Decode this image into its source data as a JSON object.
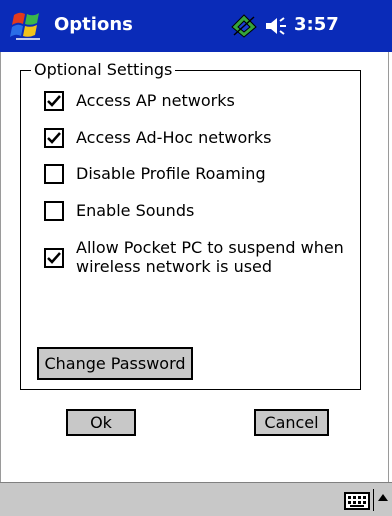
{
  "titlebar": {
    "title": "Options",
    "clock": "3:57"
  },
  "icons": {
    "start": "windows-start-icon",
    "connectivity": "connectivity-icon",
    "volume": "speaker-volume-icon",
    "keyboard": "keyboard-icon",
    "sip_menu": "up-arrow-icon"
  },
  "group": {
    "legend": "Optional Settings",
    "items": [
      {
        "label": "Access AP networks",
        "checked": true
      },
      {
        "label": "Access Ad-Hoc networks",
        "checked": true
      },
      {
        "label": "Disable Profile Roaming",
        "checked": false
      },
      {
        "label": "Enable Sounds",
        "checked": false
      },
      {
        "label_line1": "Allow Pocket PC to suspend when",
        "label_line2": "wireless network is used",
        "checked": true
      }
    ],
    "change_password": "Change Password"
  },
  "buttons": {
    "ok": "Ok",
    "cancel": "Cancel"
  },
  "colors": {
    "titlebar": "#0a2bb8",
    "button_face": "#c8c8c8"
  }
}
